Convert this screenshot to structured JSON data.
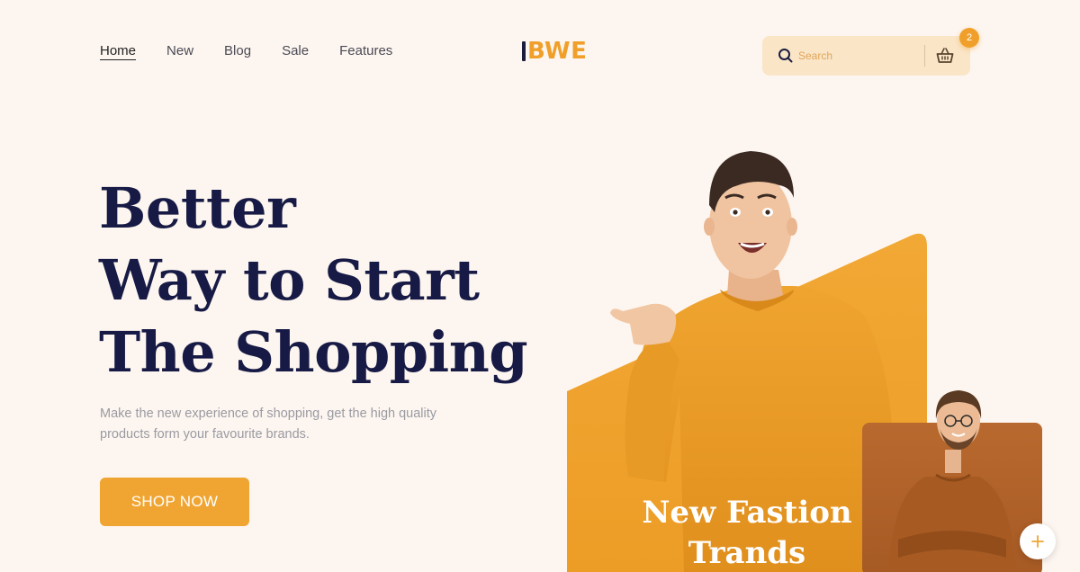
{
  "nav": {
    "items": [
      {
        "label": "Home",
        "active": true
      },
      {
        "label": "New",
        "active": false
      },
      {
        "label": "Blog",
        "active": false
      },
      {
        "label": "Sale",
        "active": false
      },
      {
        "label": "Features",
        "active": false
      }
    ]
  },
  "brand": {
    "logo_text": "BWE"
  },
  "search": {
    "placeholder": "Search",
    "icon": "search-icon"
  },
  "cart": {
    "count": "2",
    "icon": "basket-icon"
  },
  "hero": {
    "headline": [
      "Better",
      "Way to Start",
      "The Shopping"
    ],
    "subtext": "Make the new experience of shopping, get the high quality products form your favourite brands.",
    "cta_label": "SHOP NOW"
  },
  "promo": {
    "title_line1": "New Fastion",
    "title_line2": "Trands"
  },
  "side_card": {
    "icon": "plus-icon"
  },
  "colors": {
    "background": "#fdf6f0",
    "accent": "#f0a532",
    "headline": "#171a45",
    "search_bg": "#fae5c7",
    "card_brown": "#b8692e"
  }
}
